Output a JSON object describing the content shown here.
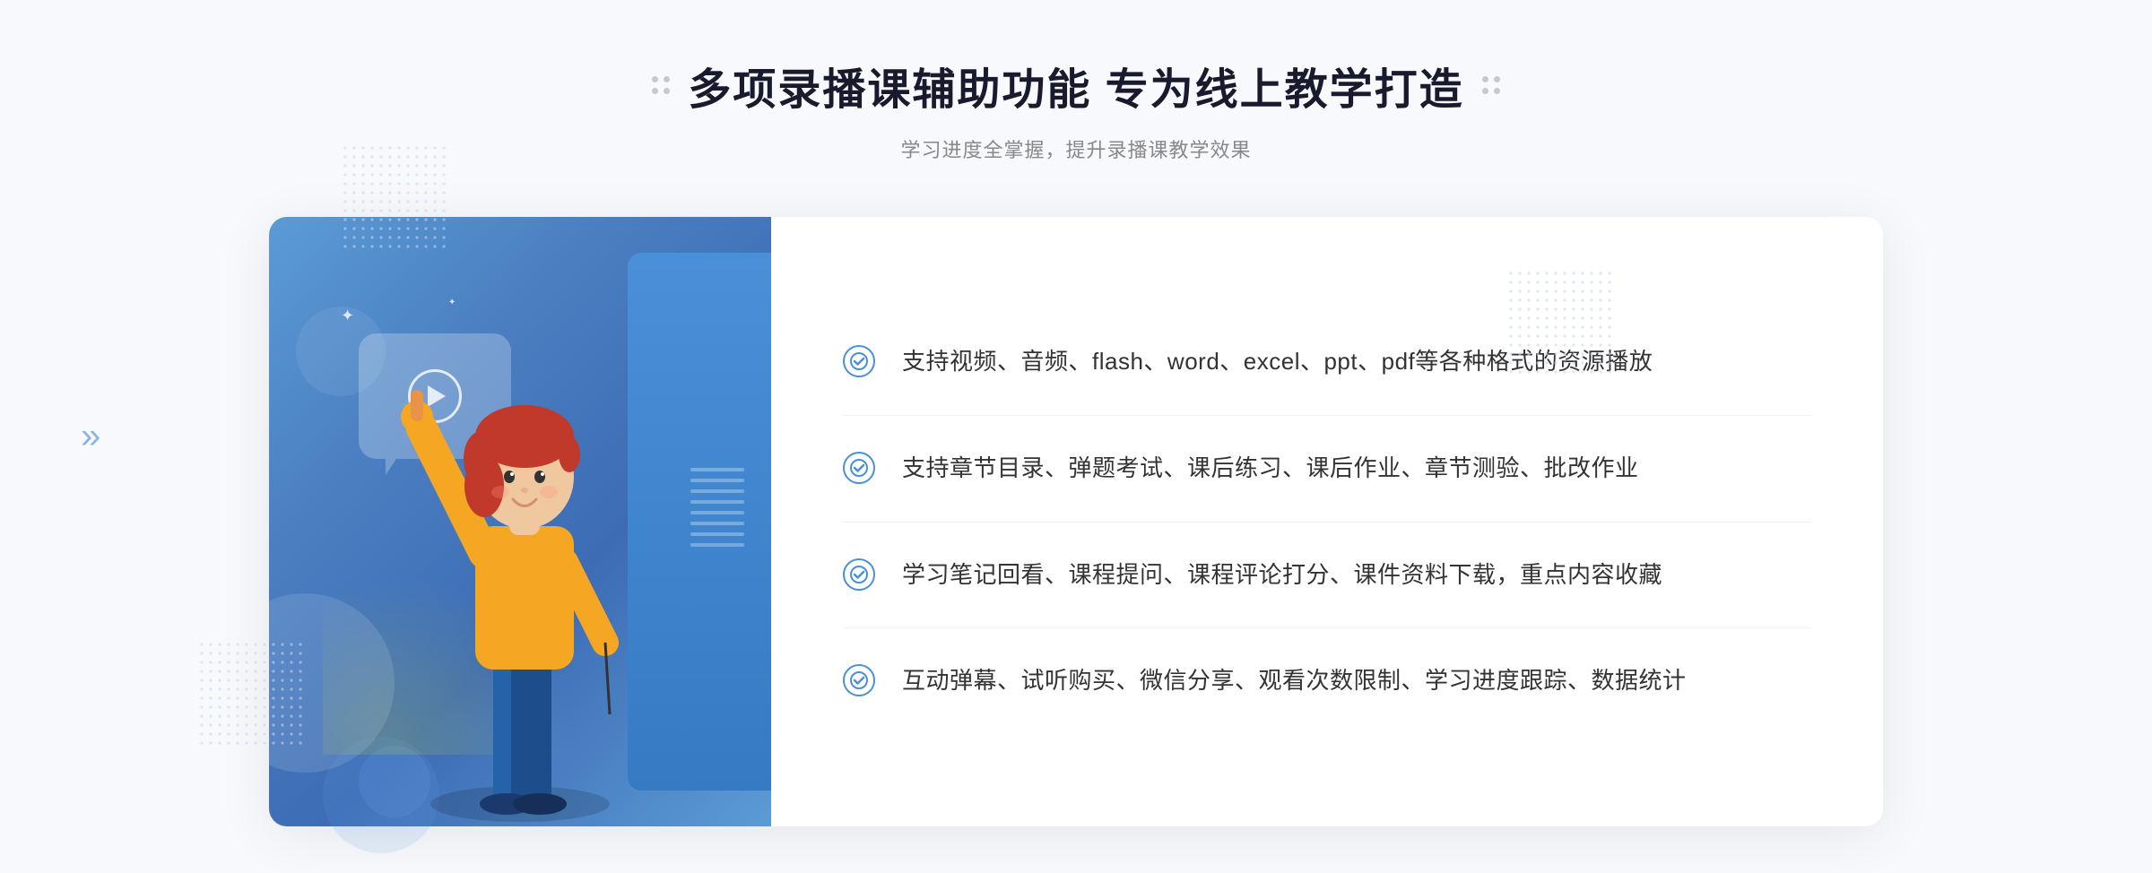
{
  "page": {
    "background": "#f8f9fc"
  },
  "header": {
    "main_title": "多项录播课辅助功能 专为线上教学打造",
    "subtitle": "学习进度全掌握，提升录播课教学效果"
  },
  "features": [
    {
      "id": 1,
      "text": "支持视频、音频、flash、word、excel、ppt、pdf等各种格式的资源播放"
    },
    {
      "id": 2,
      "text": "支持章节目录、弹题考试、课后练习、课后作业、章节测验、批改作业"
    },
    {
      "id": 3,
      "text": "学习笔记回看、课程提问、课程评论打分、课件资料下载，重点内容收藏"
    },
    {
      "id": 4,
      "text": "互动弹幕、试听购买、微信分享、观看次数限制、学习进度跟踪、数据统计"
    }
  ],
  "icons": {
    "check": "✓",
    "play": "▶",
    "chevron_left": "»",
    "sparkle": "✦"
  },
  "colors": {
    "primary_blue": "#4a90d9",
    "gradient_start": "#5b9bd5",
    "gradient_end": "#3d6cb5",
    "text_dark": "#1a1a2e",
    "text_gray": "#888888",
    "text_body": "#333333",
    "border_light": "#f0f2f5"
  }
}
